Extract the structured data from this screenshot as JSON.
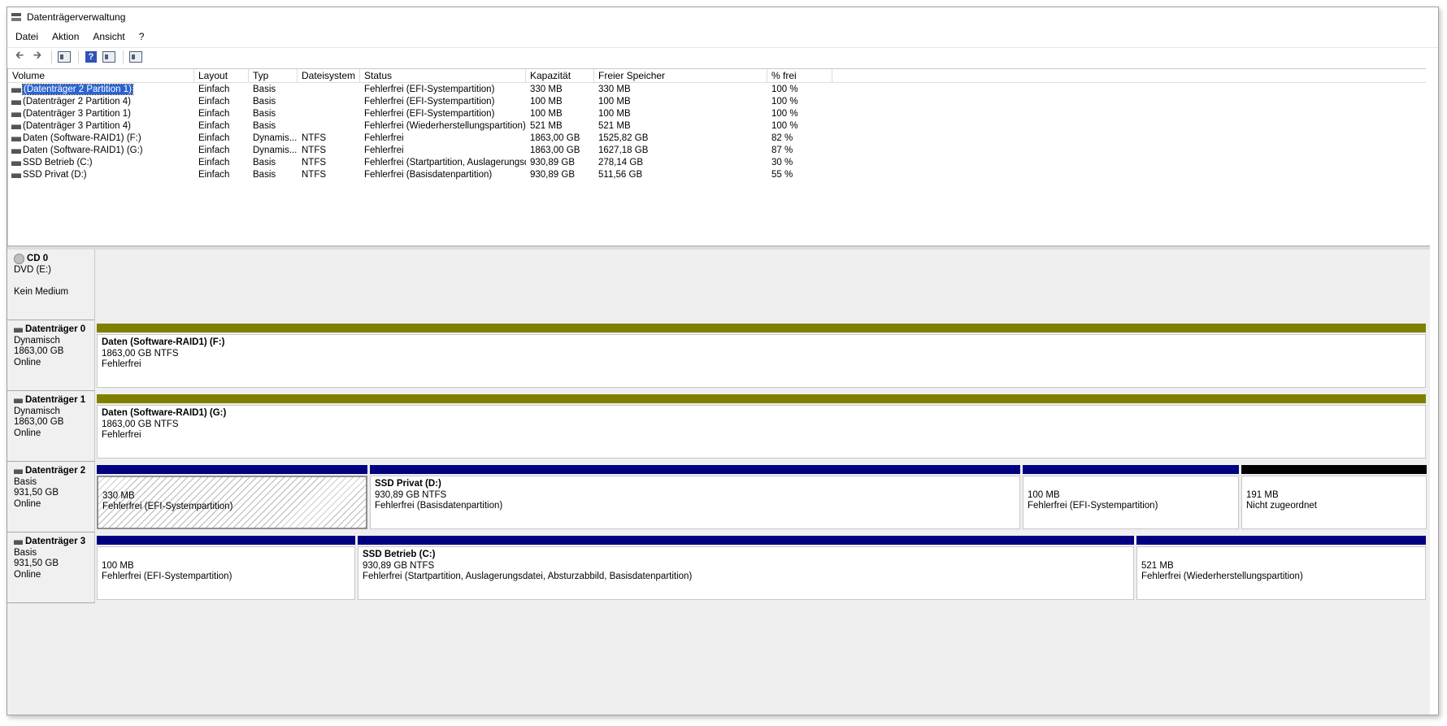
{
  "window": {
    "title": "Datenträgerverwaltung"
  },
  "menu": [
    "Datei",
    "Aktion",
    "Ansicht",
    "?"
  ],
  "toolbar": {
    "icons": [
      "back-arrow-icon",
      "forward-arrow-icon",
      "console-tree-icon",
      "help-icon",
      "properties-icon",
      "disk-list-icon"
    ]
  },
  "volume_list": {
    "columns": [
      "Volume",
      "Layout",
      "Typ",
      "Dateisystem",
      "Status",
      "Kapazität",
      "Freier Speicher",
      "% frei"
    ],
    "rows": [
      [
        "(Datenträger 2 Partition 1)",
        "Einfach",
        "Basis",
        "",
        "Fehlerfrei (EFI-Systempartition)",
        "330 MB",
        "330 MB",
        "100 %"
      ],
      [
        "(Datenträger 2 Partition 4)",
        "Einfach",
        "Basis",
        "",
        "Fehlerfrei (EFI-Systempartition)",
        "100 MB",
        "100 MB",
        "100 %"
      ],
      [
        "(Datenträger 3 Partition 1)",
        "Einfach",
        "Basis",
        "",
        "Fehlerfrei (EFI-Systempartition)",
        "100 MB",
        "100 MB",
        "100 %"
      ],
      [
        "(Datenträger 3 Partition 4)",
        "Einfach",
        "Basis",
        "",
        "Fehlerfrei (Wiederherstellungspartition)",
        "521 MB",
        "521 MB",
        "100 %"
      ],
      [
        "Daten (Software-RAID1) (F:)",
        "Einfach",
        "Dynamis...",
        "NTFS",
        "Fehlerfrei",
        "1863,00 GB",
        "1525,82 GB",
        "82 %"
      ],
      [
        "Daten (Software-RAID1) (G:)",
        "Einfach",
        "Dynamis...",
        "NTFS",
        "Fehlerfrei",
        "1863,00 GB",
        "1627,18 GB",
        "87 %"
      ],
      [
        "SSD Betrieb (C:)",
        "Einfach",
        "Basis",
        "NTFS",
        "Fehlerfrei (Startpartition, Auslagerungsd...",
        "930,89 GB",
        "278,14 GB",
        "30 %"
      ],
      [
        "SSD Privat (D:)",
        "Einfach",
        "Basis",
        "NTFS",
        "Fehlerfrei (Basisdatenpartition)",
        "930,89 GB",
        "511,56 GB",
        "55 %"
      ]
    ],
    "selected_row": 0
  },
  "disks": [
    {
      "name": "CD 0",
      "lines": [
        "DVD (E:)",
        "",
        "Kein Medium"
      ],
      "icon": "cd-icon",
      "partitions": []
    },
    {
      "name": "Datenträger 0",
      "lines": [
        "Dynamisch",
        "1863,00 GB",
        "Online"
      ],
      "icon": "disk-icon",
      "partitions": [
        {
          "title": "Daten (Software-RAID1)  (F:)",
          "size": "1863,00 GB NTFS",
          "status": "Fehlerfrei",
          "color": "#808000",
          "share": 1.0
        }
      ]
    },
    {
      "name": "Datenträger 1",
      "lines": [
        "Dynamisch",
        "1863,00 GB",
        "Online"
      ],
      "icon": "disk-icon",
      "partitions": [
        {
          "title": "Daten (Software-RAID1)  (G:)",
          "size": "1863,00 GB NTFS",
          "status": "Fehlerfrei",
          "color": "#808000",
          "share": 1.0
        }
      ]
    },
    {
      "name": "Datenträger 2",
      "lines": [
        "Basis",
        "931,50 GB",
        "Online"
      ],
      "icon": "disk-icon",
      "partitions": [
        {
          "title": "",
          "size": "330 MB",
          "status": "Fehlerfrei (EFI-Systempartition)",
          "color": "#000080",
          "share": 0.205,
          "selected": true
        },
        {
          "title": "SSD Privat  (D:)",
          "size": "930,89 GB NTFS",
          "status": "Fehlerfrei (Basisdatenpartition)",
          "color": "#000080",
          "share": 0.49
        },
        {
          "title": "",
          "size": "100 MB",
          "status": "Fehlerfrei (EFI-Systempartition)",
          "color": "#000080",
          "share": 0.164
        },
        {
          "title": "",
          "size": "191 MB",
          "status": "Nicht zugeordnet",
          "color": "#000000",
          "share": 0.141
        }
      ]
    },
    {
      "name": "Datenträger 3",
      "lines": [
        "Basis",
        "931,50 GB",
        "Online"
      ],
      "icon": "disk-icon",
      "partitions": [
        {
          "title": "",
          "size": "100 MB",
          "status": "Fehlerfrei (EFI-Systempartition)",
          "color": "#000080",
          "share": 0.196
        },
        {
          "title": "SSD Betrieb  (C:)",
          "size": "930,89 GB NTFS",
          "status": "Fehlerfrei (Startpartition, Auslagerungsdatei, Absturzabbild, Basisdatenpartition)",
          "color": "#000080",
          "share": 0.585
        },
        {
          "title": "",
          "size": "521 MB",
          "status": "Fehlerfrei (Wiederherstellungspartition)",
          "color": "#000080",
          "share": 0.219
        }
      ]
    }
  ]
}
